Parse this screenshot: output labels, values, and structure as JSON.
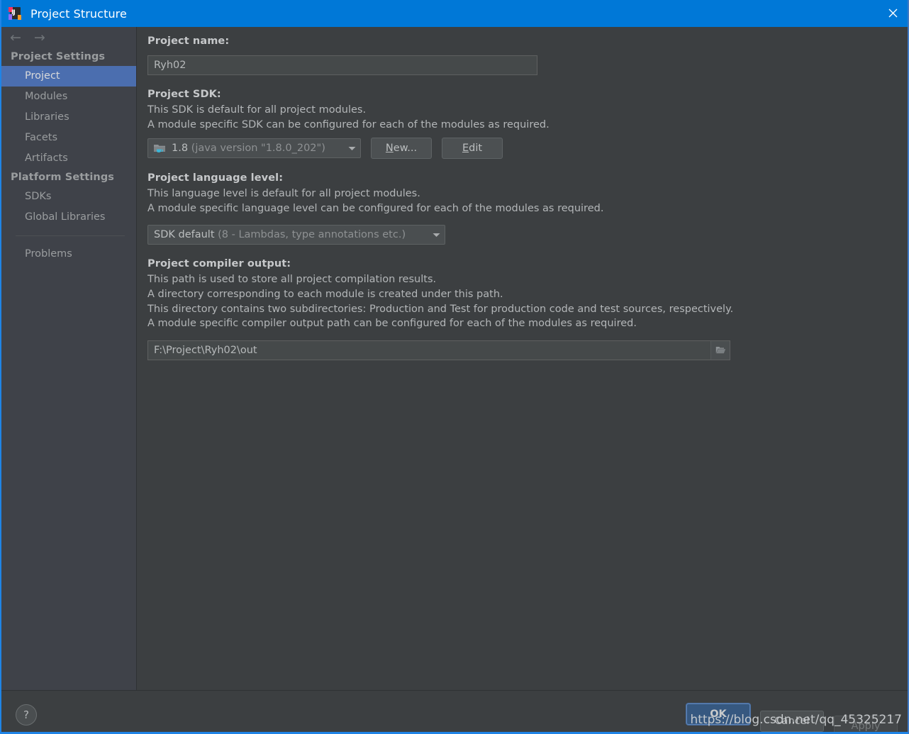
{
  "window": {
    "title": "Project Structure",
    "app_icon": "intellij-idea-icon",
    "close_icon": "close-icon",
    "titlebar_color": "#0078d7"
  },
  "sidebar": {
    "back_arrow": "←",
    "forward_arrow": "→",
    "groups": [
      {
        "header": "Project Settings",
        "items": [
          {
            "label": "Project",
            "selected": true
          },
          {
            "label": "Modules",
            "selected": false
          },
          {
            "label": "Libraries",
            "selected": false
          },
          {
            "label": "Facets",
            "selected": false
          },
          {
            "label": "Artifacts",
            "selected": false
          }
        ]
      },
      {
        "header": "Platform Settings",
        "items": [
          {
            "label": "SDKs",
            "selected": false
          },
          {
            "label": "Global Libraries",
            "selected": false
          }
        ]
      }
    ],
    "problems_label": "Problems",
    "selected_color": "#4b6eaf"
  },
  "main": {
    "project_name": {
      "label": "Project name:",
      "value": "Ryh02"
    },
    "project_sdk": {
      "label": "Project SDK:",
      "desc1": "This SDK is default for all project modules.",
      "desc2": "A module specific SDK can be configured for each of the modules as required.",
      "sdk_icon": "java-sdk-folder-icon",
      "value_primary": "1.8",
      "value_secondary": "(java version \"1.8.0_202\")",
      "new_button": "New...",
      "new_button_mnemonic": "N",
      "edit_button": "Edit",
      "edit_button_mnemonic": "E"
    },
    "language_level": {
      "label": "Project language level:",
      "desc1": "This language level is default for all project modules.",
      "desc2": "A module specific language level can be configured for each of the modules as required.",
      "value_primary": "SDK default",
      "value_secondary": "(8 - Lambdas, type annotations etc.)"
    },
    "compiler_output": {
      "label": "Project compiler output:",
      "desc1": "This path is used to store all project compilation results.",
      "desc2": "A directory corresponding to each module is created under this path.",
      "desc3": "This directory contains two subdirectories: Production and Test for production code and test sources, respectively.",
      "desc4": "A module specific compiler output path can be configured for each of the modules as required.",
      "path_value": "F:\\Project\\Ryh02\\out",
      "browse_icon": "folder-open-icon"
    }
  },
  "footer": {
    "help_label": "?",
    "help_icon": "question-mark-icon",
    "ok_label": "OK",
    "cancel_label": "Cancel",
    "apply_label": "Apply",
    "apply_disabled": true,
    "ok_color": "#365880"
  },
  "watermark": {
    "text": "https://blog.csdn.net/qq_45325217"
  }
}
